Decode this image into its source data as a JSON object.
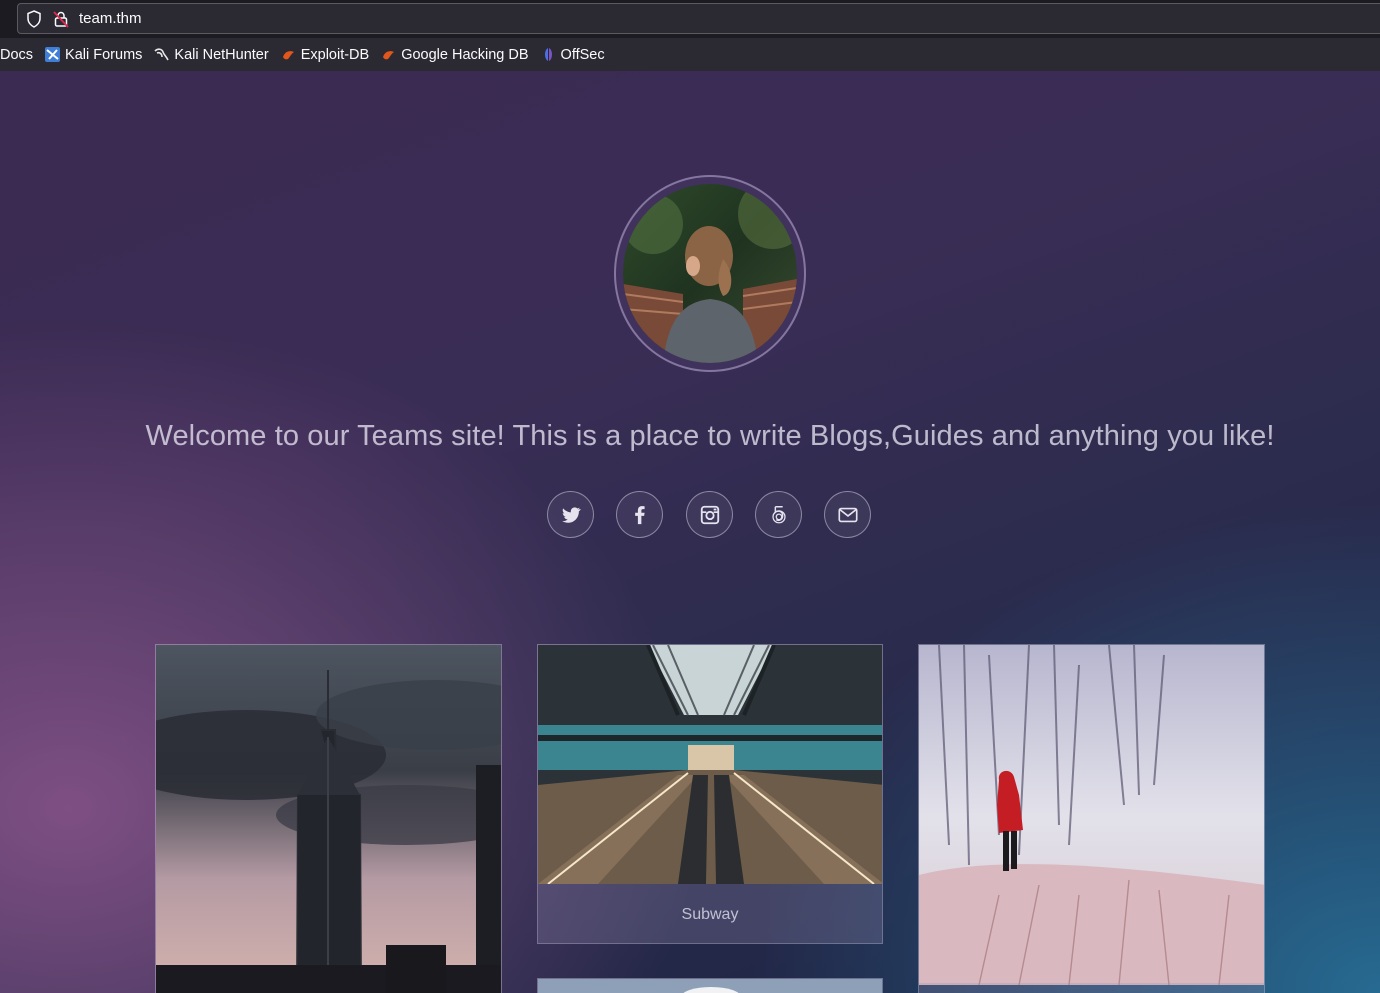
{
  "browser": {
    "url": "team.thm",
    "bookmarks": [
      {
        "label": "Docs",
        "icon": "none"
      },
      {
        "label": "Kali Forums",
        "icon": "kali-forums-icon"
      },
      {
        "label": "Kali NetHunter",
        "icon": "kali-dragon-icon"
      },
      {
        "label": "Exploit-DB",
        "icon": "exploit-db-icon"
      },
      {
        "label": "Google Hacking DB",
        "icon": "exploit-db-icon"
      },
      {
        "label": "OffSec",
        "icon": "offsec-icon"
      }
    ]
  },
  "hero": {
    "welcome_text": "Welcome to our Teams site! This is a place to write Blogs,Guides and anything you like!",
    "socials": [
      "twitter-icon",
      "facebook-icon",
      "instagram-icon",
      "500px-icon",
      "email-icon"
    ]
  },
  "gallery": {
    "cards": [
      {
        "image": "city-skyscraper-photo",
        "caption": ""
      },
      {
        "image": "subway-escalator-photo",
        "caption": "Subway"
      },
      {
        "image": "snow-hiker-photo",
        "caption": ""
      },
      {
        "image": "clouds-photo",
        "caption": ""
      }
    ]
  },
  "colors": {
    "chrome_bg": "#1c1b22",
    "toolbar_bg": "#2b2a33",
    "page_purple": "#3b2a52",
    "page_blue": "#286e96"
  }
}
